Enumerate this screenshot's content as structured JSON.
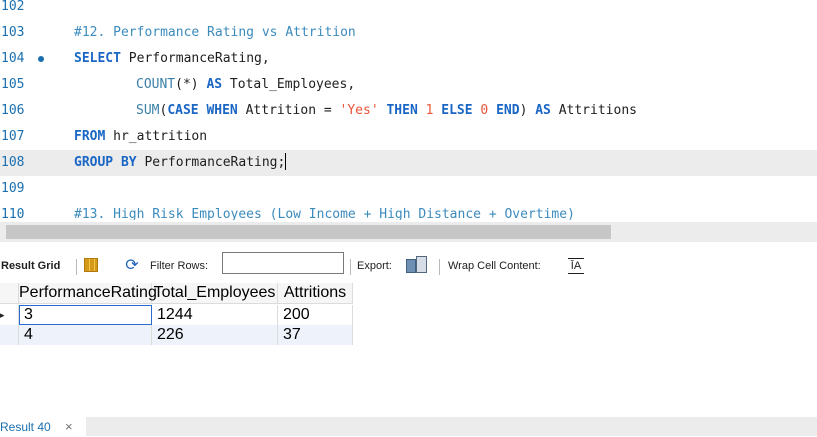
{
  "editor": {
    "lines": [
      {
        "num": "102",
        "parts": []
      },
      {
        "num": "103",
        "parts": [
          {
            "t": "#12. Performance Rating vs Attrition",
            "c": "cmt"
          }
        ]
      },
      {
        "num": "104",
        "marker": true,
        "parts": [
          {
            "t": "SELECT",
            "c": "kw"
          },
          {
            "t": " PerformanceRating,",
            "c": ""
          }
        ]
      },
      {
        "num": "105",
        "indent": true,
        "parts": [
          {
            "t": "COUNT",
            "c": "fn"
          },
          {
            "t": "(*) ",
            "c": ""
          },
          {
            "t": "AS",
            "c": "kw"
          },
          {
            "t": " Total_Employees,",
            "c": ""
          }
        ]
      },
      {
        "num": "106",
        "indent": true,
        "parts": [
          {
            "t": "SUM",
            "c": "fn"
          },
          {
            "t": "(",
            "c": ""
          },
          {
            "t": "CASE WHEN",
            "c": "kw"
          },
          {
            "t": " Attrition = ",
            "c": ""
          },
          {
            "t": "'Yes'",
            "c": "str"
          },
          {
            "t": " ",
            "c": ""
          },
          {
            "t": "THEN",
            "c": "kw"
          },
          {
            "t": " ",
            "c": ""
          },
          {
            "t": "1",
            "c": "num"
          },
          {
            "t": " ",
            "c": ""
          },
          {
            "t": "ELSE",
            "c": "kw"
          },
          {
            "t": " ",
            "c": ""
          },
          {
            "t": "0",
            "c": "num"
          },
          {
            "t": " ",
            "c": ""
          },
          {
            "t": "END",
            "c": "kw"
          },
          {
            "t": ") ",
            "c": ""
          },
          {
            "t": "AS",
            "c": "kw"
          },
          {
            "t": " Attritions",
            "c": ""
          }
        ]
      },
      {
        "num": "107",
        "parts": [
          {
            "t": "FROM",
            "c": "kw"
          },
          {
            "t": " hr_attrition",
            "c": ""
          }
        ]
      },
      {
        "num": "108",
        "current": true,
        "caret": true,
        "parts": [
          {
            "t": "GROUP BY",
            "c": "kw"
          },
          {
            "t": " PerformanceRating;",
            "c": ""
          }
        ]
      },
      {
        "num": "109",
        "parts": []
      },
      {
        "num": "110",
        "parts": [
          {
            "t": "#13. High Risk Employees (Low Income + High Distance + Overtime)",
            "c": "cmt"
          }
        ]
      }
    ]
  },
  "toolbar": {
    "result_grid_label": "Result Grid",
    "filter_rows_label": "Filter Rows:",
    "filter_value": "",
    "export_label": "Export:",
    "wrap_label": "Wrap Cell Content:",
    "wrap_icon_glyph": "ĪA",
    "refresh_icon_glyph": "⟳"
  },
  "grid": {
    "columns": [
      "PerformanceRating",
      "Total_Employees",
      "Attritions"
    ],
    "rows": [
      [
        "3",
        "1244",
        "200"
      ],
      [
        "4",
        "226",
        "37"
      ]
    ],
    "selected_marker": "▸"
  },
  "bottom_tab": {
    "label": "Result 40",
    "close": "×"
  }
}
